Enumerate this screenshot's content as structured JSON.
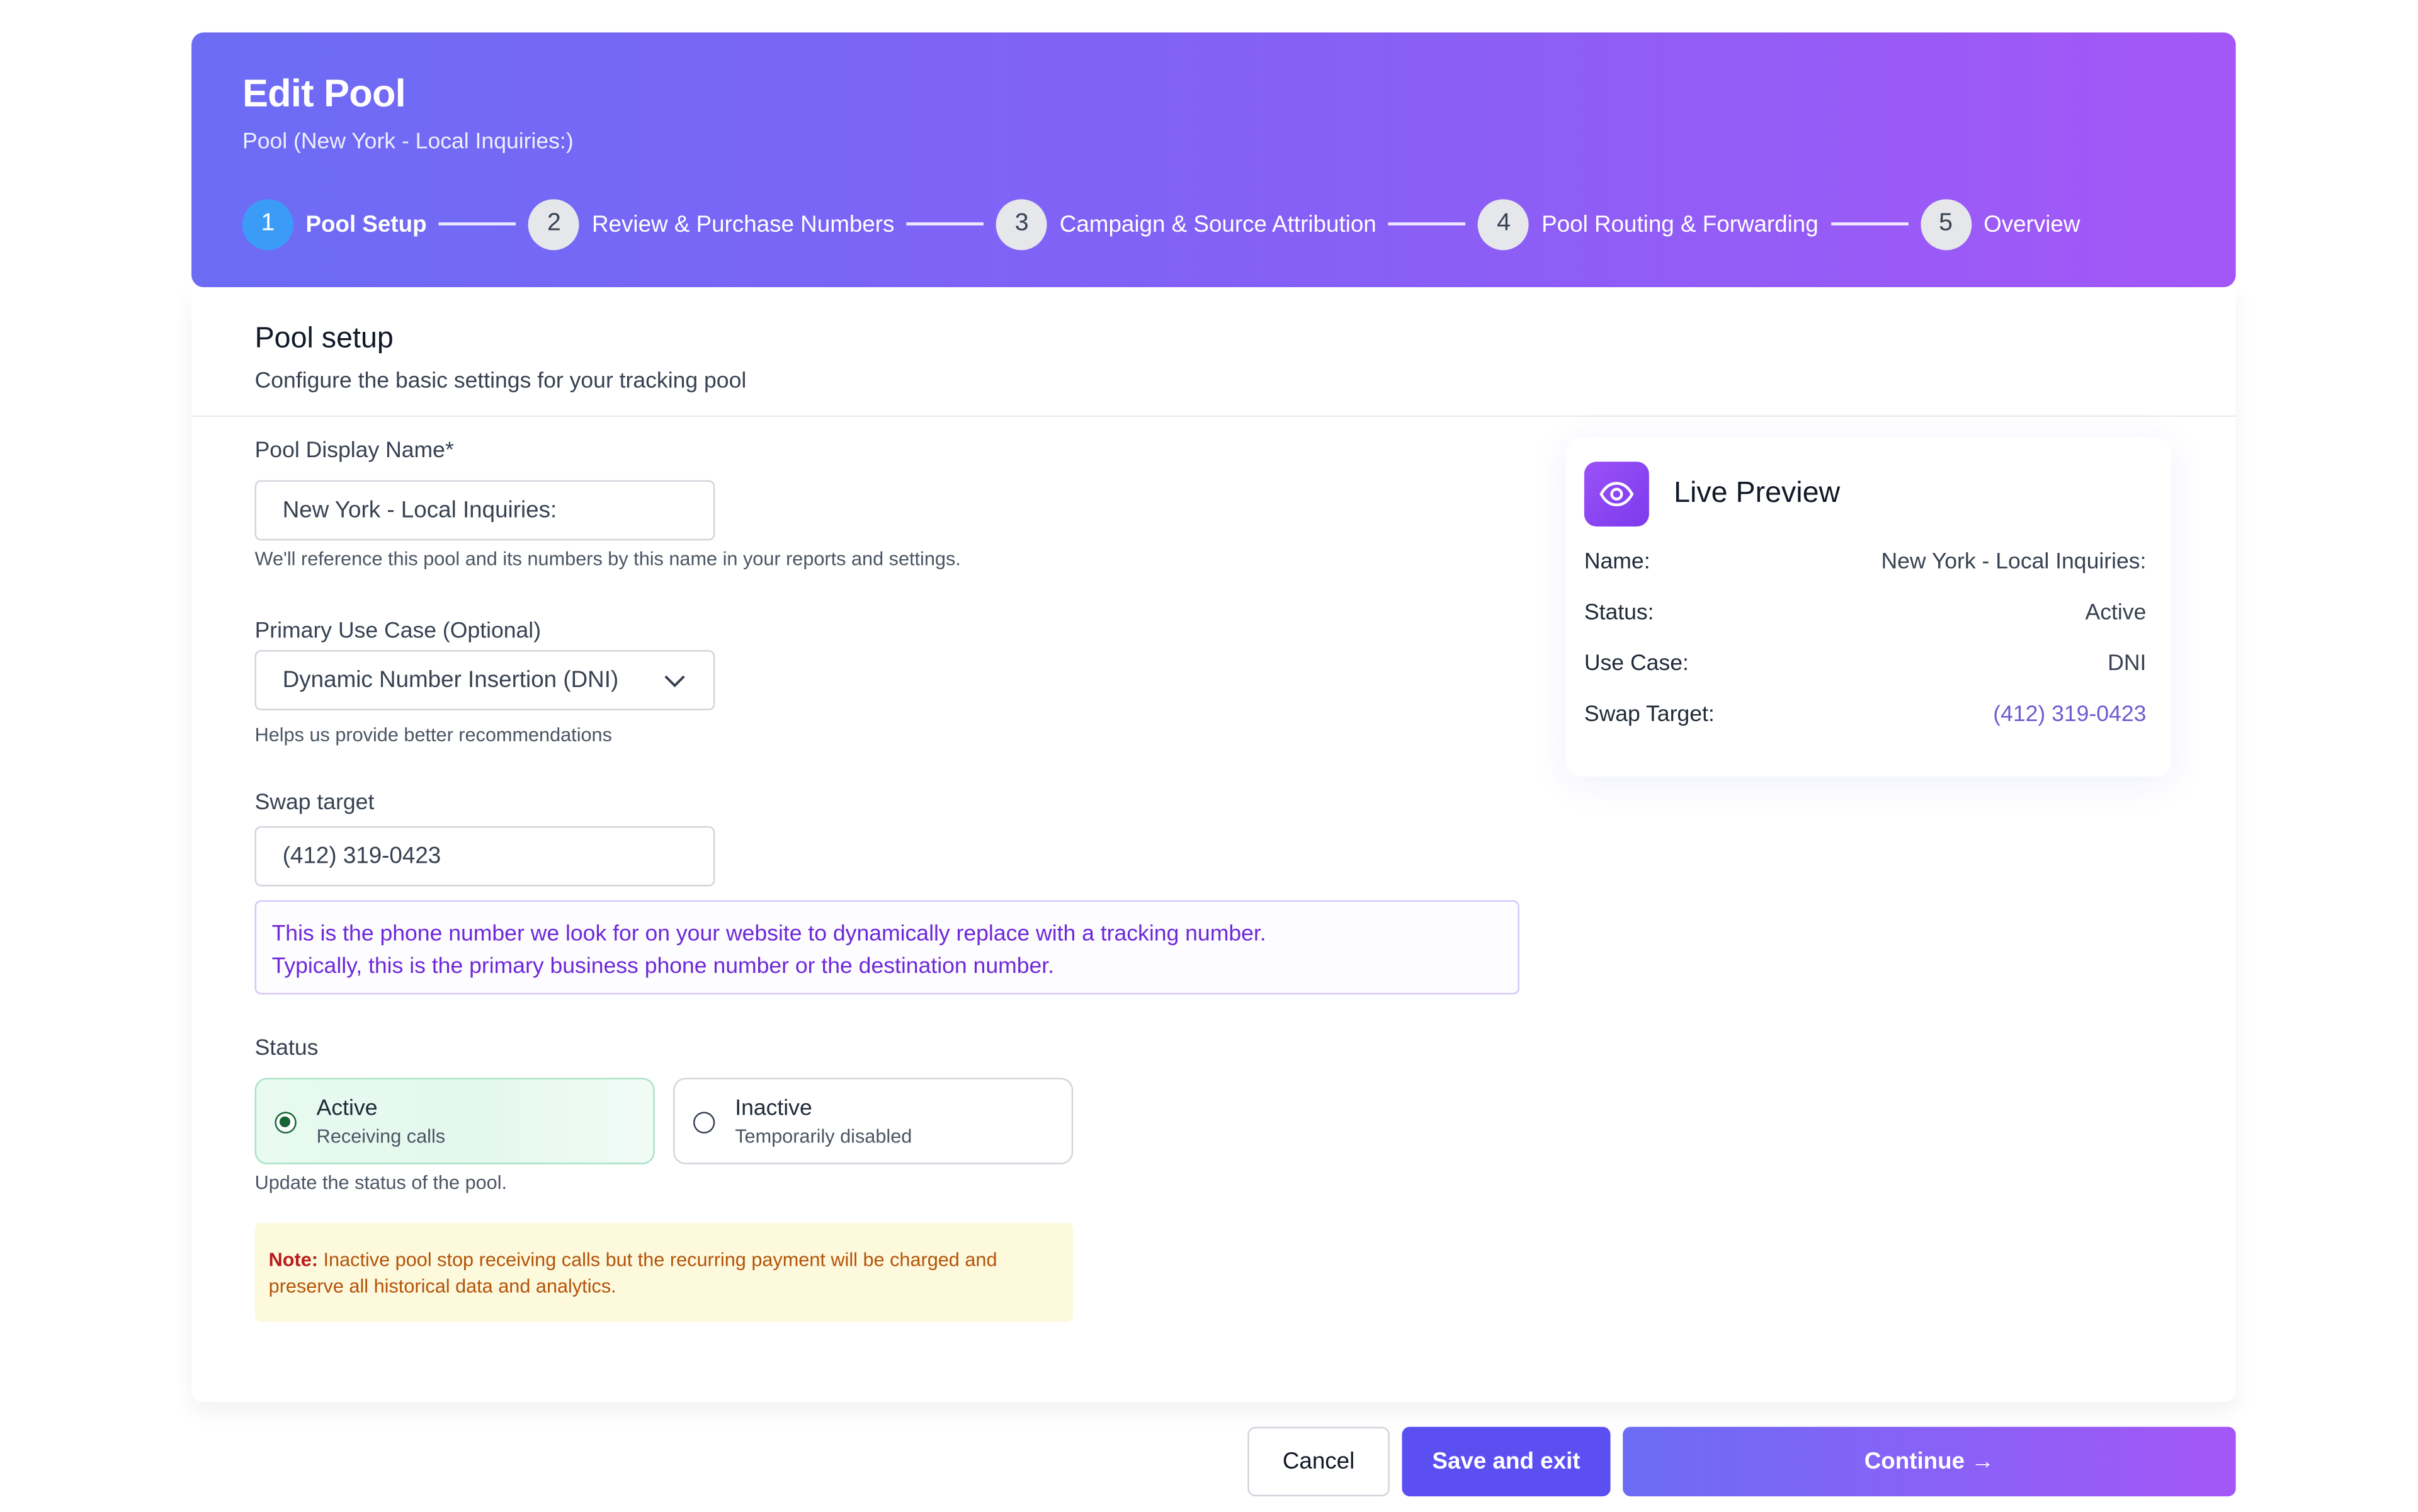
{
  "header": {
    "title": "Edit Pool",
    "subtitle": "Pool (New York - Local Inquiries:)"
  },
  "steps": [
    {
      "number": "1",
      "label": "Pool Setup",
      "active": true
    },
    {
      "number": "2",
      "label": "Review & Purchase Numbers",
      "active": false
    },
    {
      "number": "3",
      "label": "Campaign & Source Attribution",
      "active": false
    },
    {
      "number": "4",
      "label": "Pool Routing & Forwarding",
      "active": false
    },
    {
      "number": "5",
      "label": "Overview",
      "active": false
    }
  ],
  "section": {
    "title": "Pool setup",
    "description": "Configure the basic settings for your tracking pool"
  },
  "form": {
    "display_name": {
      "label": "Pool Display Name*",
      "value": "New York - Local Inquiries:",
      "helper": "We'll reference this pool and its numbers by this name in your reports and settings."
    },
    "use_case": {
      "label": "Primary Use Case (Optional)",
      "value": "Dynamic Number Insertion (DNI)",
      "helper": "Helps us provide better recommendations"
    },
    "swap_target": {
      "label": "Swap target",
      "value": "(412) 319-0423",
      "info_line1": "This is the phone number we look for on your website to dynamically replace with a tracking number.",
      "info_line2": "Typically, this is the primary business phone number or the destination number."
    },
    "status": {
      "label": "Status",
      "options": [
        {
          "title": "Active",
          "subtitle": "Receiving calls",
          "selected": true
        },
        {
          "title": "Inactive",
          "subtitle": "Temporarily disabled",
          "selected": false
        }
      ],
      "helper": "Update the status of the pool.",
      "note_label": "Note:",
      "note_text": " Inactive pool stop receiving calls but the recurring payment will be charged and preserve all historical data and analytics."
    }
  },
  "preview": {
    "title": "Live Preview",
    "icon": "eye-icon",
    "rows": [
      {
        "key": "Name:",
        "value": "New York - Local Inquiries:"
      },
      {
        "key": "Status:",
        "value": "Active"
      },
      {
        "key": "Use Case:",
        "value": "DNI"
      },
      {
        "key": "Swap Target:",
        "value": "(412) 319-0423"
      }
    ]
  },
  "actions": {
    "cancel": "Cancel",
    "save": "Save and exit",
    "continue": "Continue →"
  },
  "colors": {
    "header_gradient_start": "#6c6cf5",
    "header_gradient_end": "#a457f7",
    "active_step": "#3b9cf7",
    "primary_button": "#5b4ff2",
    "link": "#6d5bd0",
    "info_text": "#6d28d9",
    "active_status_bg": "#e8faf1",
    "note_bg": "#fdf9dc"
  }
}
